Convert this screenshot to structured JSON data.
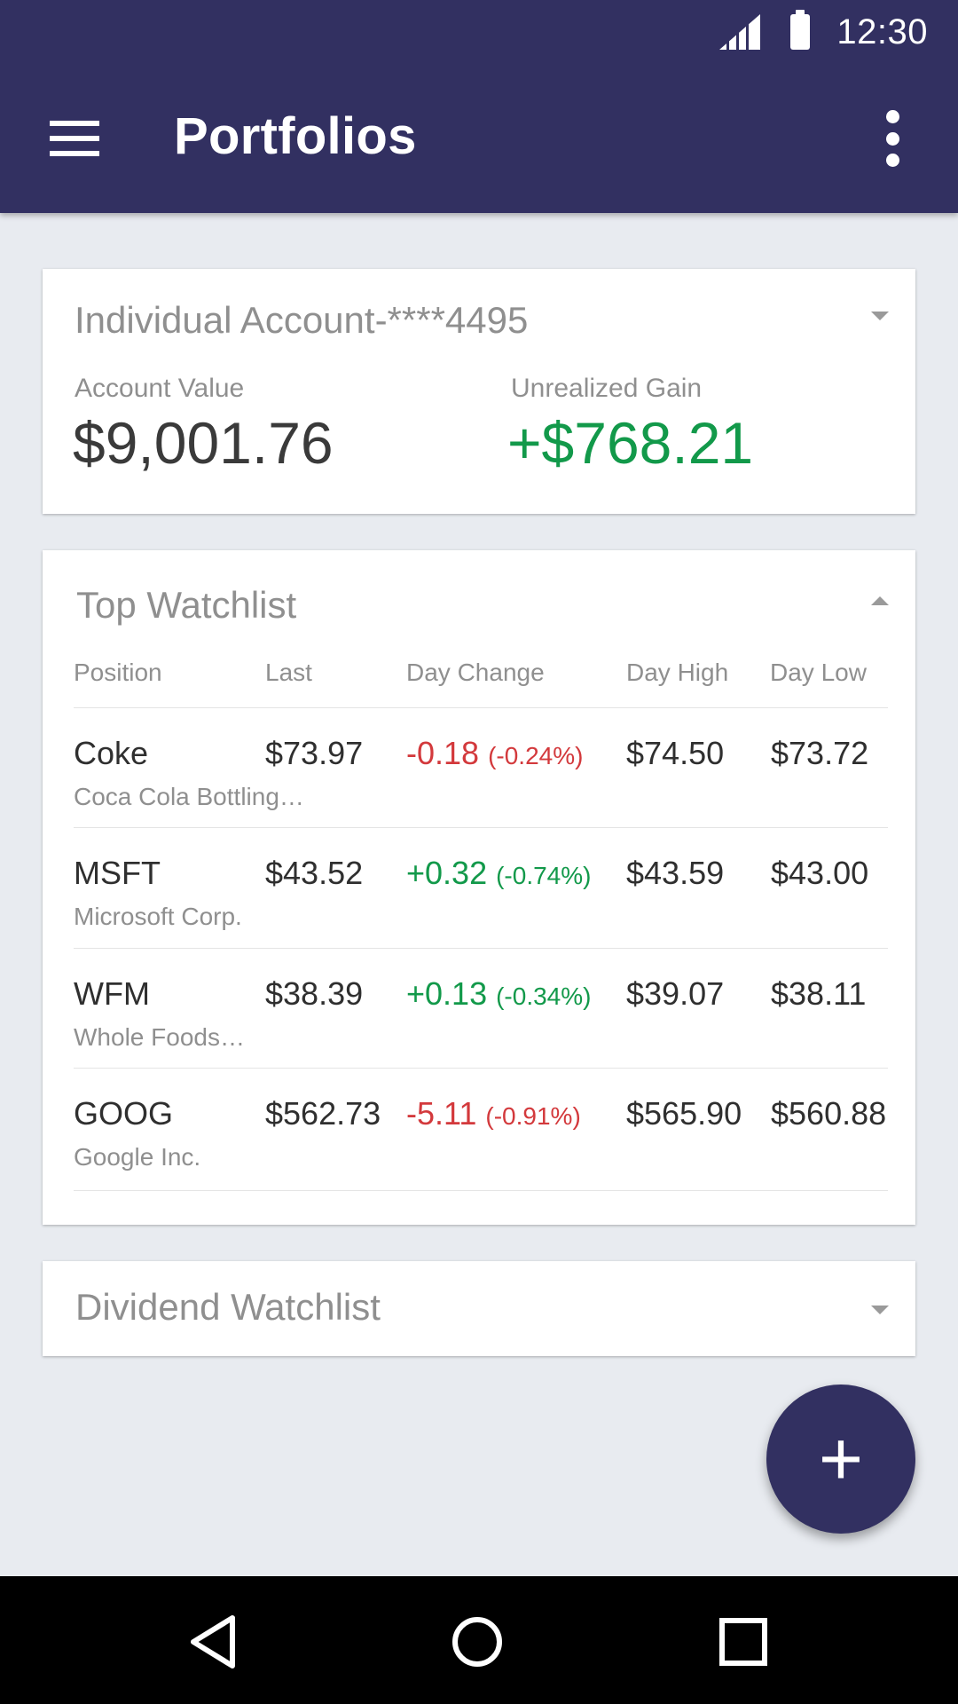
{
  "status_bar": {
    "time": "12:30",
    "signal_icon": "signal-icon",
    "battery_icon": "battery-icon"
  },
  "app_bar": {
    "title": "Portfolios",
    "menu_icon": "hamburger-menu-icon",
    "overflow_icon": "more-vert-icon"
  },
  "account_card": {
    "title": "Individual Account-****4495",
    "account_value_label": "Account Value",
    "account_value": "$9,001.76",
    "unrealized_gain_label": "Unrealized Gain",
    "unrealized_gain": "+$768.21"
  },
  "top_watchlist": {
    "title": "Top Watchlist",
    "columns": {
      "position": "Position",
      "last": "Last",
      "day_change": "Day Change",
      "day_high": "Day High",
      "day_low": "Day Low"
    },
    "rows": [
      {
        "symbol": "Coke",
        "name": "Coca Cola Bottling…",
        "last": "$73.97",
        "change": "-0.18",
        "change_pct": "(-0.24%)",
        "direction": "neg",
        "day_high": "$74.50",
        "day_low": "$73.72"
      },
      {
        "symbol": "MSFT",
        "name": "Microsoft Corp.",
        "last": "$43.52",
        "change": "+0.32",
        "change_pct": "(-0.74%)",
        "direction": "pos",
        "day_high": "$43.59",
        "day_low": "$43.00"
      },
      {
        "symbol": "WFM",
        "name": "Whole Foods…",
        "last": "$38.39",
        "change": "+0.13",
        "change_pct": "(-0.34%)",
        "direction": "pos",
        "day_high": "$39.07",
        "day_low": "$38.11"
      },
      {
        "symbol": "GOOG",
        "name": "Google Inc.",
        "last": "$562.73",
        "change": "-5.11",
        "change_pct": "(-0.91%)",
        "direction": "neg",
        "day_high": "$565.90",
        "day_low": "$560.88"
      }
    ]
  },
  "dividend_watchlist": {
    "title": "Dividend Watchlist"
  },
  "fab": {
    "label": "+",
    "icon": "add-icon"
  },
  "nav_bar": {
    "back_icon": "back-icon",
    "home_icon": "home-icon",
    "recents_icon": "recents-icon"
  },
  "colors": {
    "primary": "#323061",
    "positive": "#12994a",
    "negative": "#d3393c",
    "background": "#e8ebf0"
  }
}
